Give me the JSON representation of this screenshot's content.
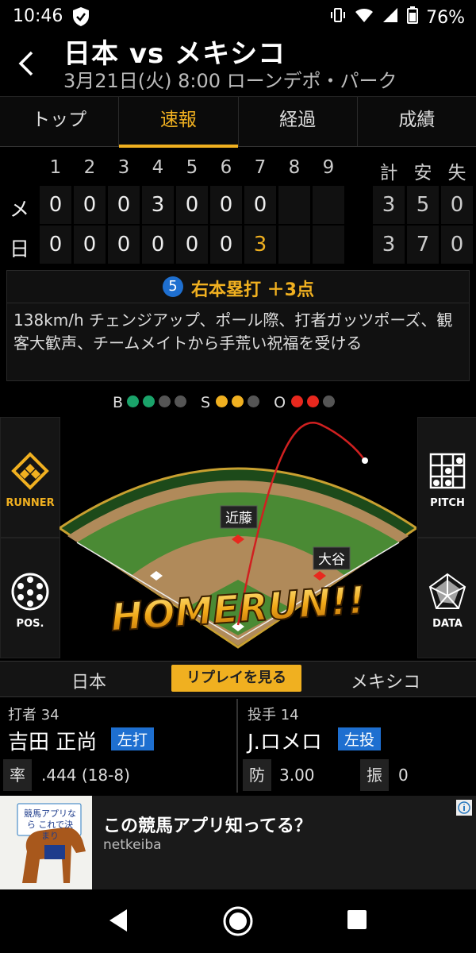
{
  "status_bar": {
    "time": "10:46",
    "battery": "76%"
  },
  "header": {
    "title": "日本 vs メキシコ",
    "subtitle": "3月21日(火) 8:00 ローンデポ・パーク"
  },
  "tabs": [
    {
      "label": "トップ",
      "active": false
    },
    {
      "label": "速報",
      "active": true
    },
    {
      "label": "経過",
      "active": false
    },
    {
      "label": "成績",
      "active": false
    }
  ],
  "scoreboard": {
    "innings": [
      "1",
      "2",
      "3",
      "4",
      "5",
      "6",
      "7",
      "8",
      "9"
    ],
    "total_headers": [
      "計",
      "安",
      "失"
    ],
    "teams": [
      {
        "label": "メ",
        "scores": [
          "0",
          "0",
          "0",
          "3",
          "0",
          "0",
          "0",
          "",
          ""
        ],
        "totals": [
          "3",
          "5",
          "0"
        ]
      },
      {
        "label": "日",
        "scores": [
          "0",
          "0",
          "0",
          "0",
          "0",
          "0",
          "3",
          "",
          ""
        ],
        "totals": [
          "3",
          "7",
          "0"
        ]
      }
    ]
  },
  "play": {
    "number": "5",
    "title": "右本塁打 ＋3点",
    "description": "138km/h チェンジアップ、ポール際、打者ガッツポーズ、観客大歓声、チームメイトから手荒い祝福を受ける"
  },
  "count": {
    "b_label": "B",
    "s_label": "S",
    "o_label": "O",
    "balls": 2,
    "balls_max": 4,
    "strikes": 2,
    "strikes_max": 3,
    "outs": 2,
    "outs_max": 3,
    "colors": {
      "ball": "#1aa36a",
      "strike": "#f0b020",
      "out": "#e8281e",
      "off": "#555555"
    }
  },
  "field": {
    "runner_label": "RUNNER",
    "pitch_label": "PITCH",
    "pos_label": "POS.",
    "data_label": "DATA",
    "runners": {
      "second": "近藤",
      "first": "大谷"
    },
    "banner": "HOMERUN!!"
  },
  "bottom_bar": {
    "left_team": "日本",
    "replay_label": "リプレイを見る",
    "right_team": "メキシコ"
  },
  "batter": {
    "role": "打者 34",
    "name": "吉田 正尚",
    "badge": "左打",
    "stat_label": "率",
    "stat_value": ".444 (18-8)"
  },
  "pitcher": {
    "role": "投手 14",
    "name": "J.ロメロ",
    "badge": "左投",
    "stat1_label": "防",
    "stat1_value": "3.00",
    "stat2_label": "振",
    "stat2_value": "0"
  },
  "ad": {
    "title": "この競馬アプリ知ってる？",
    "sponsor": "netkeiba",
    "image_text": "競馬アプリなら これで決まり"
  }
}
